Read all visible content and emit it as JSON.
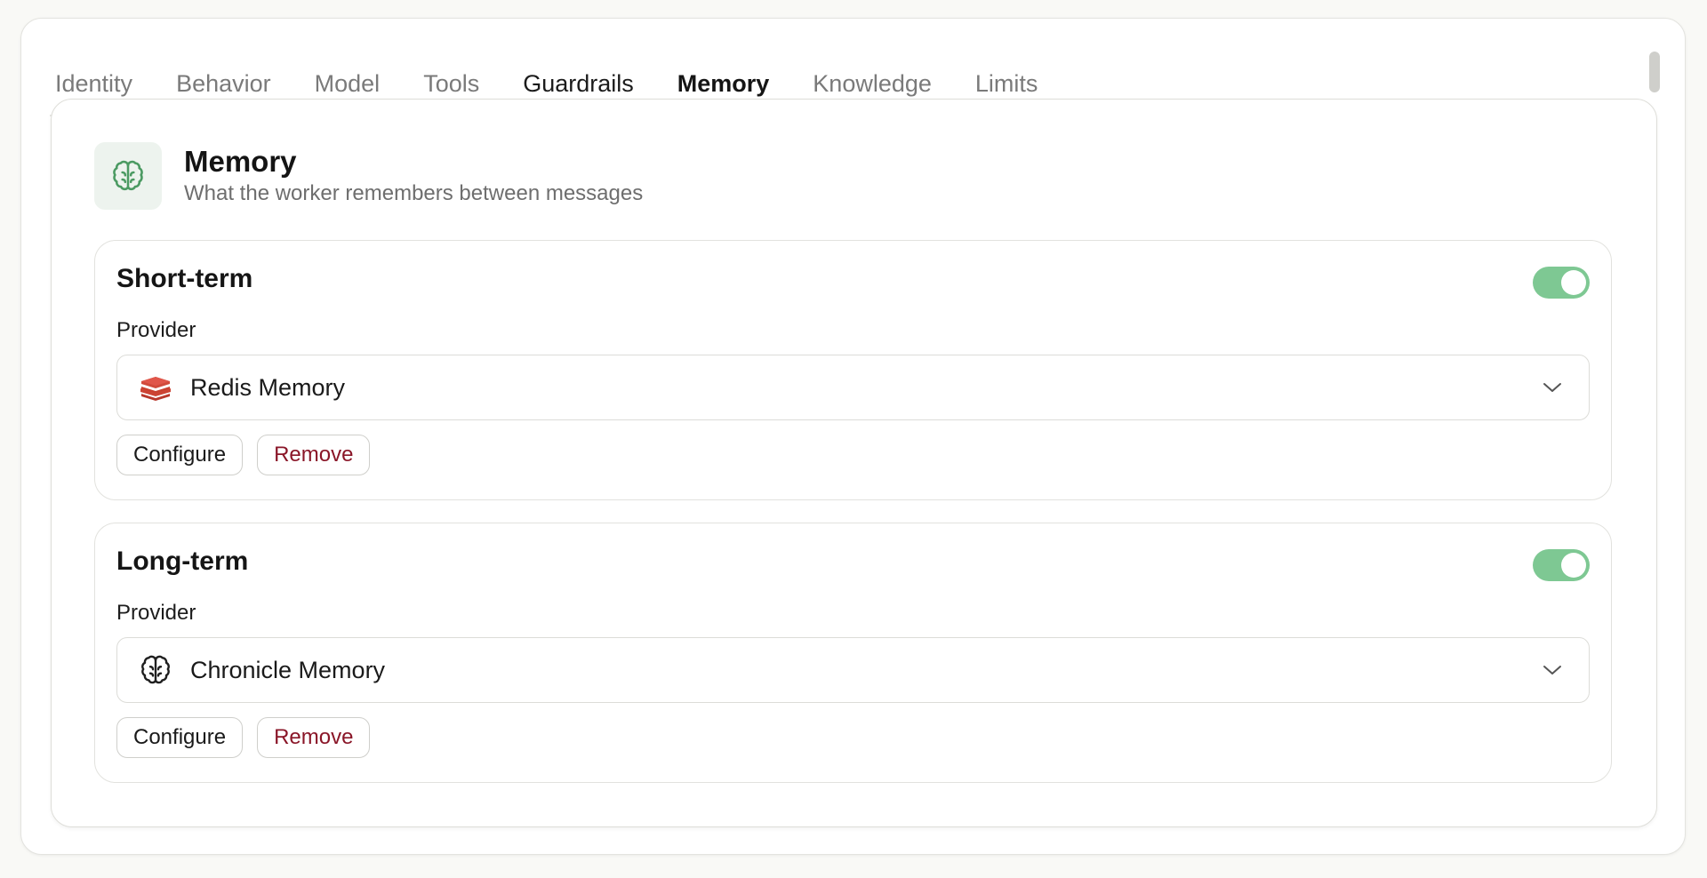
{
  "tabs": [
    {
      "label": "Identity"
    },
    {
      "label": "Behavior"
    },
    {
      "label": "Model"
    },
    {
      "label": "Tools"
    },
    {
      "label": "Guardrails"
    },
    {
      "label": "Memory"
    },
    {
      "label": "Knowledge"
    },
    {
      "label": "Limits"
    }
  ],
  "active_tab": "Memory",
  "section": {
    "icon": "brain-icon",
    "title": "Memory",
    "subtitle": "What the worker remembers between messages"
  },
  "short_term": {
    "title": "Short-term",
    "enabled": true,
    "provider_label": "Provider",
    "provider_icon": "redis-icon",
    "provider_value": "Redis Memory",
    "configure_label": "Configure",
    "remove_label": "Remove"
  },
  "long_term": {
    "title": "Long-term",
    "enabled": true,
    "provider_label": "Provider",
    "provider_icon": "brain-icon",
    "provider_value": "Chronicle Memory",
    "configure_label": "Configure",
    "remove_label": "Remove"
  },
  "colors": {
    "accent": "#5aa36c",
    "toggle_on": "#7ec893",
    "remove_text": "#8a1628",
    "redis": "#d14a3b"
  }
}
